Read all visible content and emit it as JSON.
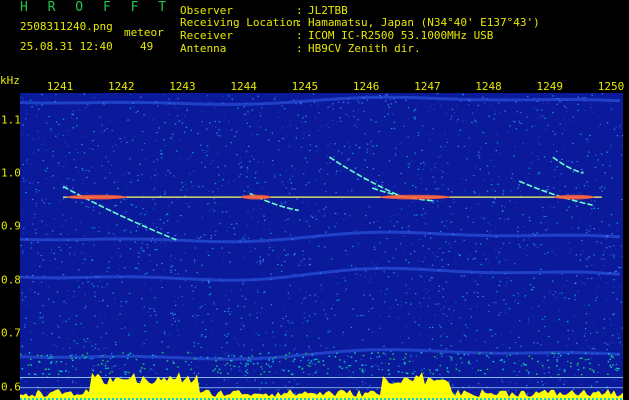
{
  "header": {
    "brand": "H R O F F T",
    "filename": "2508311240.png",
    "datetime": "25.08.31 12:40",
    "meteor_label": "meteor",
    "meteor_count": "49"
  },
  "info": [
    {
      "key": "Observer",
      "value": "JL2TBB"
    },
    {
      "key": "Receiving Location",
      "value": "Hamamatsu, Japan (N34°40' E137°43')"
    },
    {
      "key": "Receiver",
      "value": "ICOM IC-R2500 53.1000MHz USB"
    },
    {
      "key": "Antenna",
      "value": "HB9CV Zenith dir."
    }
  ],
  "colon": ":",
  "chart_data": {
    "type": "heatmap",
    "unit_label": "kHz",
    "x_ticks": [
      "1241",
      "1242",
      "1243",
      "1244",
      "1245",
      "1246",
      "1247",
      "1248",
      "1249",
      "1250"
    ],
    "y_ticks": [
      "1.1",
      "1.0",
      "0.9",
      "0.8",
      "0.7",
      "0.6"
    ],
    "x_range": [
      1241,
      1250
    ],
    "y_range": [
      0.575,
      1.15
    ],
    "background_color": "#0a1a9a",
    "carrier_freq": 0.955,
    "colors": {
      "text": "#e8e800",
      "brand": "#21c44c",
      "trace": "#ffff66",
      "echo": "#ff5a3c",
      "noise": "#00d0d0",
      "level": "#ffff00"
    }
  }
}
